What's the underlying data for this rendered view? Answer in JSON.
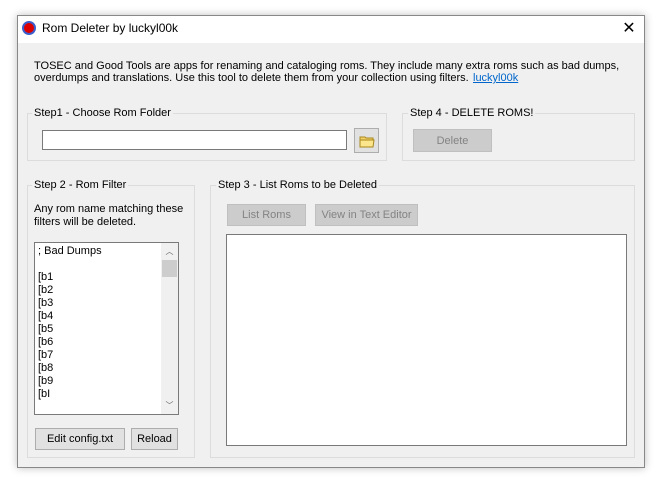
{
  "window": {
    "title": "Rom Deleter by luckyl00k",
    "close_icon": "close-icon"
  },
  "description": {
    "line1": "TOSEC and Good Tools are apps for renaming and cataloging roms. They include many extra roms such as bad dumps,",
    "line2": "overdumps and translations. Use this tool to delete them from your collection using filters.",
    "link": "luckyl00k"
  },
  "step1": {
    "label": "Step1 - Choose Rom Folder",
    "folder_value": ""
  },
  "step4": {
    "label": "Step 4 - DELETE ROMS!",
    "delete": "Delete"
  },
  "step2": {
    "label": "Step 2 - Rom Filter",
    "help1": "Any rom name matching these",
    "help2": "filters will be deleted.",
    "filters": [
      "; Bad Dumps",
      "",
      "[b1",
      "[b2",
      "[b3",
      "[b4",
      "[b5",
      "[b6",
      "[b7",
      "[b8",
      "[b9",
      "[bI"
    ],
    "edit": "Edit config.txt",
    "reload": "Reload"
  },
  "step3": {
    "label": "Step 3 - List Roms to be Deleted",
    "list": "List Roms",
    "view": "View in Text Editor"
  }
}
